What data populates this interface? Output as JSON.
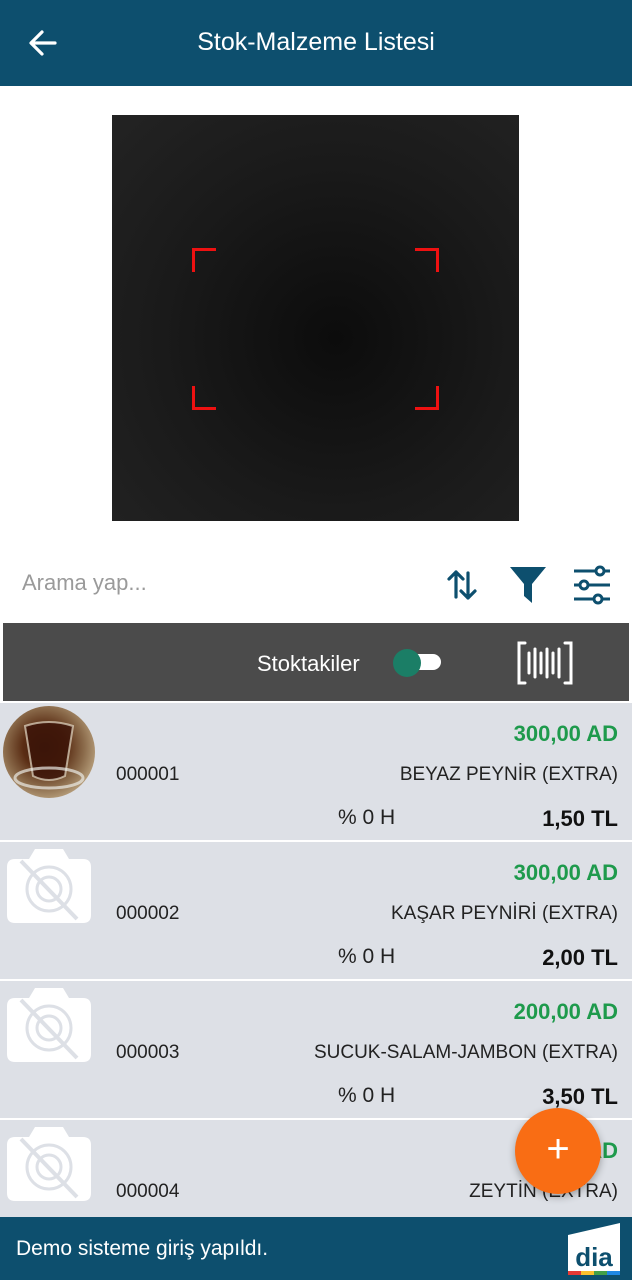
{
  "appbar": {
    "title": "Stok-Malzeme Listesi"
  },
  "search": {
    "placeholder": "Arama yap..."
  },
  "filterbar": {
    "stock_toggle_label": "Stoktakiler",
    "stock_toggle_on": true
  },
  "items": [
    {
      "code": "000001",
      "quantity": "300,00  AD",
      "name": "BEYAZ PEYNİR (EXTRA)",
      "tax": "% 0 H",
      "price": "1,50  TL",
      "has_image": true
    },
    {
      "code": "000002",
      "quantity": "300,00  AD",
      "name": "KAŞAR PEYNİRİ (EXTRA)",
      "tax": "% 0 H",
      "price": "2,00  TL",
      "has_image": false
    },
    {
      "code": "000003",
      "quantity": "200,00  AD",
      "name": "SUCUK-SALAM-JAMBON (EXTRA)",
      "tax": "% 0 H",
      "price": "3,50  TL",
      "has_image": false
    },
    {
      "code": "000004",
      "quantity": "AD",
      "name": "ZEYTİN (EXTRA)",
      "tax": "",
      "price": "",
      "has_image": false
    }
  ],
  "fab": {
    "icon": "plus-icon",
    "label": "+"
  },
  "snackbar": {
    "message": "Demo sisteme giriş yapıldı.",
    "logo_text": "dia"
  },
  "colors": {
    "primary": "#0d4f6e",
    "accent": "#f96d14",
    "quantity": "#1e9a4c",
    "list_bg": "#dde0e6",
    "filterbar_bg": "#4b4b4b"
  }
}
